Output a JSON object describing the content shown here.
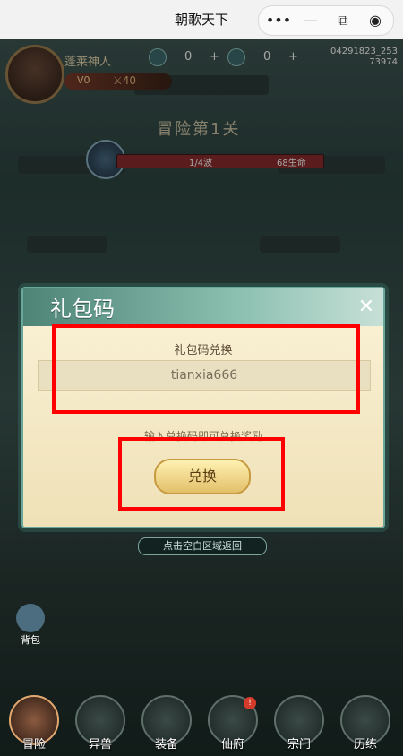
{
  "window": {
    "title": "朝歌天下"
  },
  "capsule": {
    "more_icon": "more-dots-icon",
    "minimize_icon": "minimize-icon",
    "swap_icon": "swap-icon",
    "close_icon": "record-icon"
  },
  "player": {
    "name": "蓬莱神人",
    "vip": "V0",
    "power_label": "40",
    "resource1": "0",
    "resource2": "0",
    "uid_line1": "04291823_253",
    "uid_line2": "73974"
  },
  "stage": {
    "title": "冒险第1关",
    "wave": "1/4波",
    "hp": "68生命",
    "wave_fraction": 0.25
  },
  "modal": {
    "title": "礼包码",
    "section_label": "礼包码兑换",
    "input_value": "tianxia666",
    "hint": "输入兑换码即可兑换奖励",
    "redeem_label": "兑换",
    "close_glyph": "✕"
  },
  "tap_to_close": "点击空白区域返回",
  "bag_label": "背包",
  "nav": [
    {
      "label": "冒险",
      "active": true,
      "badge": ""
    },
    {
      "label": "异兽",
      "active": false,
      "badge": ""
    },
    {
      "label": "装备",
      "active": false,
      "badge": ""
    },
    {
      "label": "仙府",
      "active": false,
      "badge": "!"
    },
    {
      "label": "宗门",
      "active": false,
      "badge": ""
    },
    {
      "label": "历练",
      "active": false,
      "badge": ""
    }
  ],
  "colors": {
    "highlight": "#ff0000",
    "modal_border": "#6aa699",
    "button_gold": "#e2c06a"
  }
}
